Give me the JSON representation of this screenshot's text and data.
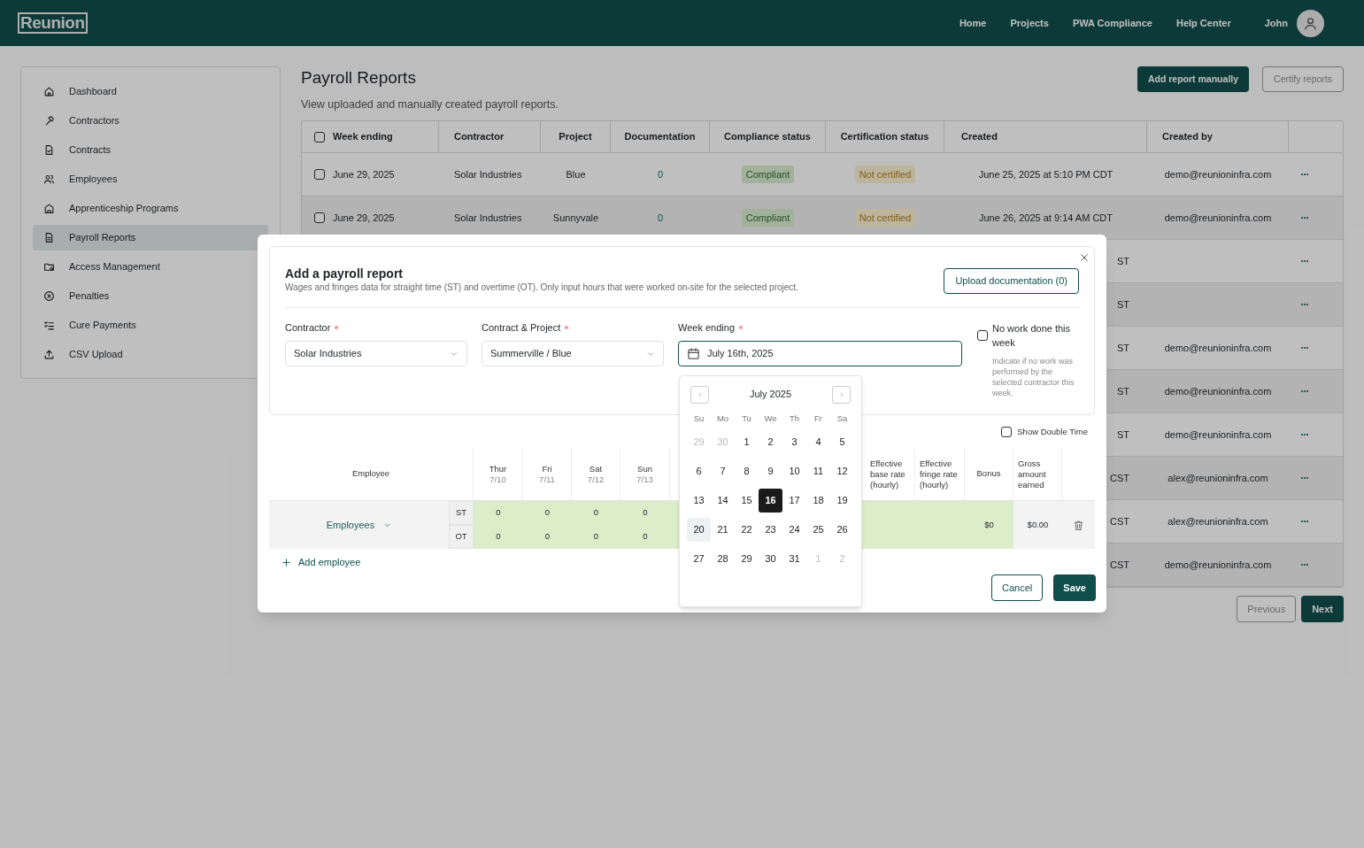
{
  "brand": "Reunion",
  "nav": [
    {
      "label": "Home"
    },
    {
      "label": "Projects"
    },
    {
      "label": "PWA Compliance"
    },
    {
      "label": "Help Center"
    }
  ],
  "user": {
    "name": "John"
  },
  "sidebar": {
    "items": [
      {
        "label": "Dashboard",
        "selected": false
      },
      {
        "label": "Contractors",
        "selected": false
      },
      {
        "label": "Contracts",
        "selected": false
      },
      {
        "label": "Employees",
        "selected": false
      },
      {
        "label": "Apprenticeship Programs",
        "selected": false
      },
      {
        "label": "Payroll Reports",
        "selected": true
      },
      {
        "label": "Access Management",
        "selected": false
      },
      {
        "label": "Penalties",
        "selected": false
      },
      {
        "label": "Cure Payments",
        "selected": false
      },
      {
        "label": "CSV Upload",
        "selected": false
      }
    ]
  },
  "page": {
    "title": "Payroll Reports",
    "subtitle": "View uploaded and manually created payroll reports.",
    "actions": [
      {
        "label": "Add report manually",
        "disabled": false
      },
      {
        "label": "Certify reports",
        "disabled": true
      }
    ]
  },
  "table": {
    "all_checked": false,
    "columns": [
      {
        "label": "Week ending"
      },
      {
        "label": "Contractor"
      },
      {
        "label": "Project"
      },
      {
        "label": "Documentation"
      },
      {
        "label": "Compliance status"
      },
      {
        "label": "Certification status"
      },
      {
        "label": "Created"
      },
      {
        "label": "Created by"
      }
    ],
    "rows": [
      {
        "checked": false,
        "week_ending": "June 29, 2025",
        "contractor": "Solar Industries",
        "project": "Blue",
        "documentation": "0",
        "compliance_status": "Compliant",
        "certification_status": "Not certified",
        "created": "June 25, 2025 at 5:10 PM CDT",
        "created_by": "demo@reunioninfra.com"
      },
      {
        "checked": false,
        "week_ending": "June 29, 2025",
        "contractor": "Solar Industries",
        "project": "Sunnyvale",
        "documentation": "0",
        "compliance_status": "Compliant",
        "certification_status": "Not certified",
        "created": "June 26, 2025 at 9:14 AM CDT",
        "created_by": "demo@reunioninfra.com"
      },
      {
        "created": "ST"
      },
      {
        "created": "ST"
      },
      {
        "created": "ST",
        "created_by": "demo@reunioninfra.com"
      },
      {
        "created": "ST",
        "created_by": "demo@reunioninfra.com"
      },
      {
        "created": "ST",
        "created_by": "demo@reunioninfra.com"
      },
      {
        "created": "CST",
        "created_by": "alex@reunioninfra.com"
      },
      {
        "created": "CST",
        "created_by": "alex@reunioninfra.com"
      },
      {
        "created": "CST",
        "created_by": "demo@reunioninfra.com"
      }
    ]
  },
  "pagination": {
    "previous": {
      "label": "Previous",
      "disabled": true
    },
    "next": {
      "label": "Next",
      "disabled": false
    }
  },
  "modal": {
    "title": "Add a payroll report",
    "description": "Wages and fringes data for straight time (ST) and overtime (OT). Only input hours that were worked on-site for the selected project.",
    "upload_button": "Upload documentation (0)",
    "fields": [
      {
        "kind": "select",
        "label": "Contractor",
        "required": true,
        "value": "Solar Industries",
        "focused": false
      },
      {
        "kind": "select",
        "label": "Contract & Project",
        "required": true,
        "value": "Summerville / Blue",
        "focused": false
      },
      {
        "kind": "date",
        "label": "Week ending",
        "required": true,
        "value": "July 16th, 2025",
        "focused": true
      }
    ],
    "no_work": {
      "label": "No work done this week",
      "checked": false,
      "hint": "Indicate if no work was performed by the selected contractor this week."
    },
    "calendar": {
      "month": "July 2025",
      "weekdays": [
        "Su",
        "Mo",
        "Tu",
        "We",
        "Th",
        "Fr",
        "Sa"
      ],
      "days": [
        {
          "label": "29",
          "outside": true,
          "selected": false,
          "highlighted": false
        },
        {
          "label": "30",
          "outside": true,
          "selected": false,
          "highlighted": false
        },
        {
          "label": "1",
          "outside": false,
          "selected": false,
          "highlighted": false
        },
        {
          "label": "2",
          "outside": false,
          "selected": false,
          "highlighted": false
        },
        {
          "label": "3",
          "outside": false,
          "selected": false,
          "highlighted": false
        },
        {
          "label": "4",
          "outside": false,
          "selected": false,
          "highlighted": false
        },
        {
          "label": "5",
          "outside": false,
          "selected": false,
          "highlighted": false
        },
        {
          "label": "6",
          "outside": false,
          "selected": false,
          "highlighted": false
        },
        {
          "label": "7",
          "outside": false,
          "selected": false,
          "highlighted": false
        },
        {
          "label": "8",
          "outside": false,
          "selected": false,
          "highlighted": false
        },
        {
          "label": "9",
          "outside": false,
          "selected": false,
          "highlighted": false
        },
        {
          "label": "10",
          "outside": false,
          "selected": false,
          "highlighted": false
        },
        {
          "label": "11",
          "outside": false,
          "selected": false,
          "highlighted": false
        },
        {
          "label": "12",
          "outside": false,
          "selected": false,
          "highlighted": false
        },
        {
          "label": "13",
          "outside": false,
          "selected": false,
          "highlighted": false
        },
        {
          "label": "14",
          "outside": false,
          "selected": false,
          "highlighted": false
        },
        {
          "label": "15",
          "outside": false,
          "selected": false,
          "highlighted": false
        },
        {
          "label": "16",
          "outside": false,
          "selected": true,
          "highlighted": false
        },
        {
          "label": "17",
          "outside": false,
          "selected": false,
          "highlighted": false
        },
        {
          "label": "18",
          "outside": false,
          "selected": false,
          "highlighted": false
        },
        {
          "label": "19",
          "outside": false,
          "selected": false,
          "highlighted": false
        },
        {
          "label": "20",
          "outside": false,
          "selected": false,
          "highlighted": true
        },
        {
          "label": "21",
          "outside": false,
          "selected": false,
          "highlighted": false
        },
        {
          "label": "22",
          "outside": false,
          "selected": false,
          "highlighted": false
        },
        {
          "label": "23",
          "outside": false,
          "selected": false,
          "highlighted": false
        },
        {
          "label": "24",
          "outside": false,
          "selected": false,
          "highlighted": false
        },
        {
          "label": "25",
          "outside": false,
          "selected": false,
          "highlighted": false
        },
        {
          "label": "26",
          "outside": false,
          "selected": false,
          "highlighted": false
        },
        {
          "label": "27",
          "outside": false,
          "selected": false,
          "highlighted": false
        },
        {
          "label": "28",
          "outside": false,
          "selected": false,
          "highlighted": false
        },
        {
          "label": "29",
          "outside": false,
          "selected": false,
          "highlighted": false
        },
        {
          "label": "30",
          "outside": false,
          "selected": false,
          "highlighted": false
        },
        {
          "label": "31",
          "outside": false,
          "selected": false,
          "highlighted": false
        },
        {
          "label": "1",
          "outside": true,
          "selected": false,
          "highlighted": false
        },
        {
          "label": "2",
          "outside": true,
          "selected": false,
          "highlighted": false
        }
      ]
    },
    "show_double_time": {
      "label": "Show Double Time",
      "checked": false
    },
    "timesheet": {
      "columns": [
        {
          "kind": "employee",
          "label": "Employee"
        },
        {
          "kind": "day",
          "label": "Thur",
          "sub": "7/10"
        },
        {
          "kind": "day",
          "label": "Fri",
          "sub": "7/11"
        },
        {
          "kind": "day",
          "label": "Sat",
          "sub": "7/12"
        },
        {
          "kind": "day",
          "label": "Sun",
          "sub": "7/13"
        },
        {
          "kind": "rate",
          "label": "Effective base rate (hourly)"
        },
        {
          "kind": "rate",
          "label": "Effective fringe rate (hourly)"
        },
        {
          "kind": "bonus",
          "label": "Bonus"
        },
        {
          "kind": "gross",
          "label": "Gross amount earned"
        }
      ],
      "rows": [
        {
          "employee": "Employees",
          "hours": [
            {
              "label": "ST",
              "values": [
                "0",
                "0",
                "0",
                "0"
              ]
            },
            {
              "label": "OT",
              "values": [
                "0",
                "0",
                "0",
                "0"
              ]
            }
          ],
          "bonus": "$0",
          "gross": "$0.00"
        }
      ]
    },
    "add_employee": "Add employee",
    "buttons": [
      {
        "label": "Cancel",
        "kind": "secondary"
      },
      {
        "label": "Save",
        "kind": "primary"
      }
    ]
  }
}
